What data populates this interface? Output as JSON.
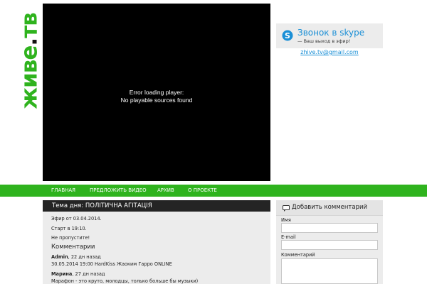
{
  "logo": {
    "text": "живе",
    "dot": ".",
    "suffix": "тв",
    "color": "#2fb31e"
  },
  "player": {
    "error_line1": "Error loading player:",
    "error_line2": "No playable sources found"
  },
  "skype": {
    "title": "Звонок в skype",
    "subtitle": "— Ваш выход в эфир!",
    "icon": "skype-icon",
    "email": "zhive.tv@gmail.com"
  },
  "nav": {
    "color": "#2fb31e",
    "items": [
      "Главная",
      "Предложить видео",
      "Архив",
      "О проекте"
    ]
  },
  "topic": {
    "title": "Тема дня: ПОЛІТИЧНА АГІТАЦІЯ",
    "air_date": "Эфир от 03.04.2014.",
    "start_time": "Старт в 19:10.",
    "reminder": "Не пропустите!"
  },
  "comments": {
    "title": "Комментарии",
    "items": [
      {
        "author": "Admin",
        "meta": ", 22 дн назад",
        "text": "30.05.2014 19:00 HardKiss Жаоким Гарро ONLINE"
      },
      {
        "author": "Марина",
        "meta": ", 27 дн назад",
        "text": "Марафон - это круто, молодцы, только больше бы музыки)"
      }
    ]
  },
  "comment_form": {
    "title": "Добавить комментарий",
    "name_label": "Имя",
    "name_value": "",
    "email_label": "E-mail",
    "email_value": "",
    "comment_label": "Комментарий",
    "comment_value": ""
  }
}
